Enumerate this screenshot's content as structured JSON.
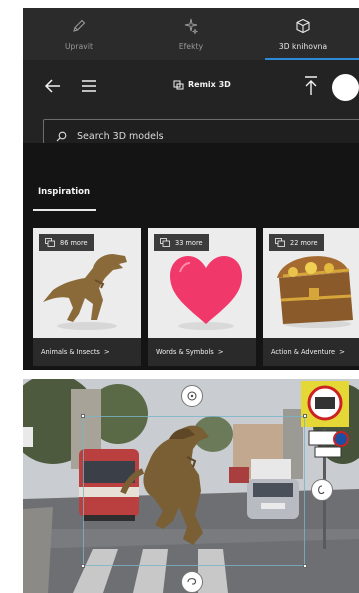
{
  "tabs": [
    {
      "label": "Upravit",
      "icon": "pencil-icon",
      "active": false
    },
    {
      "label": "Efekty",
      "icon": "sparkle-icon",
      "active": false
    },
    {
      "label": "3D knihovna",
      "icon": "cube-icon",
      "active": true
    }
  ],
  "header": {
    "brand": "Remix 3D",
    "search_placeholder": "Search 3D models"
  },
  "inspiration": {
    "tab_label": "Inspiration",
    "cards": [
      {
        "badge": "86 more",
        "label": "Animals & Insects",
        "chevron": ">"
      },
      {
        "badge": "33 more",
        "label": "Words & Symbols",
        "chevron": ">"
      },
      {
        "badge": "22 more",
        "label": "Action & Adventure",
        "chevron": ">"
      }
    ]
  },
  "colors": {
    "accent": "#2e8ad6",
    "heart": "#f0386b",
    "panel_bg": "#1f1f1f"
  }
}
